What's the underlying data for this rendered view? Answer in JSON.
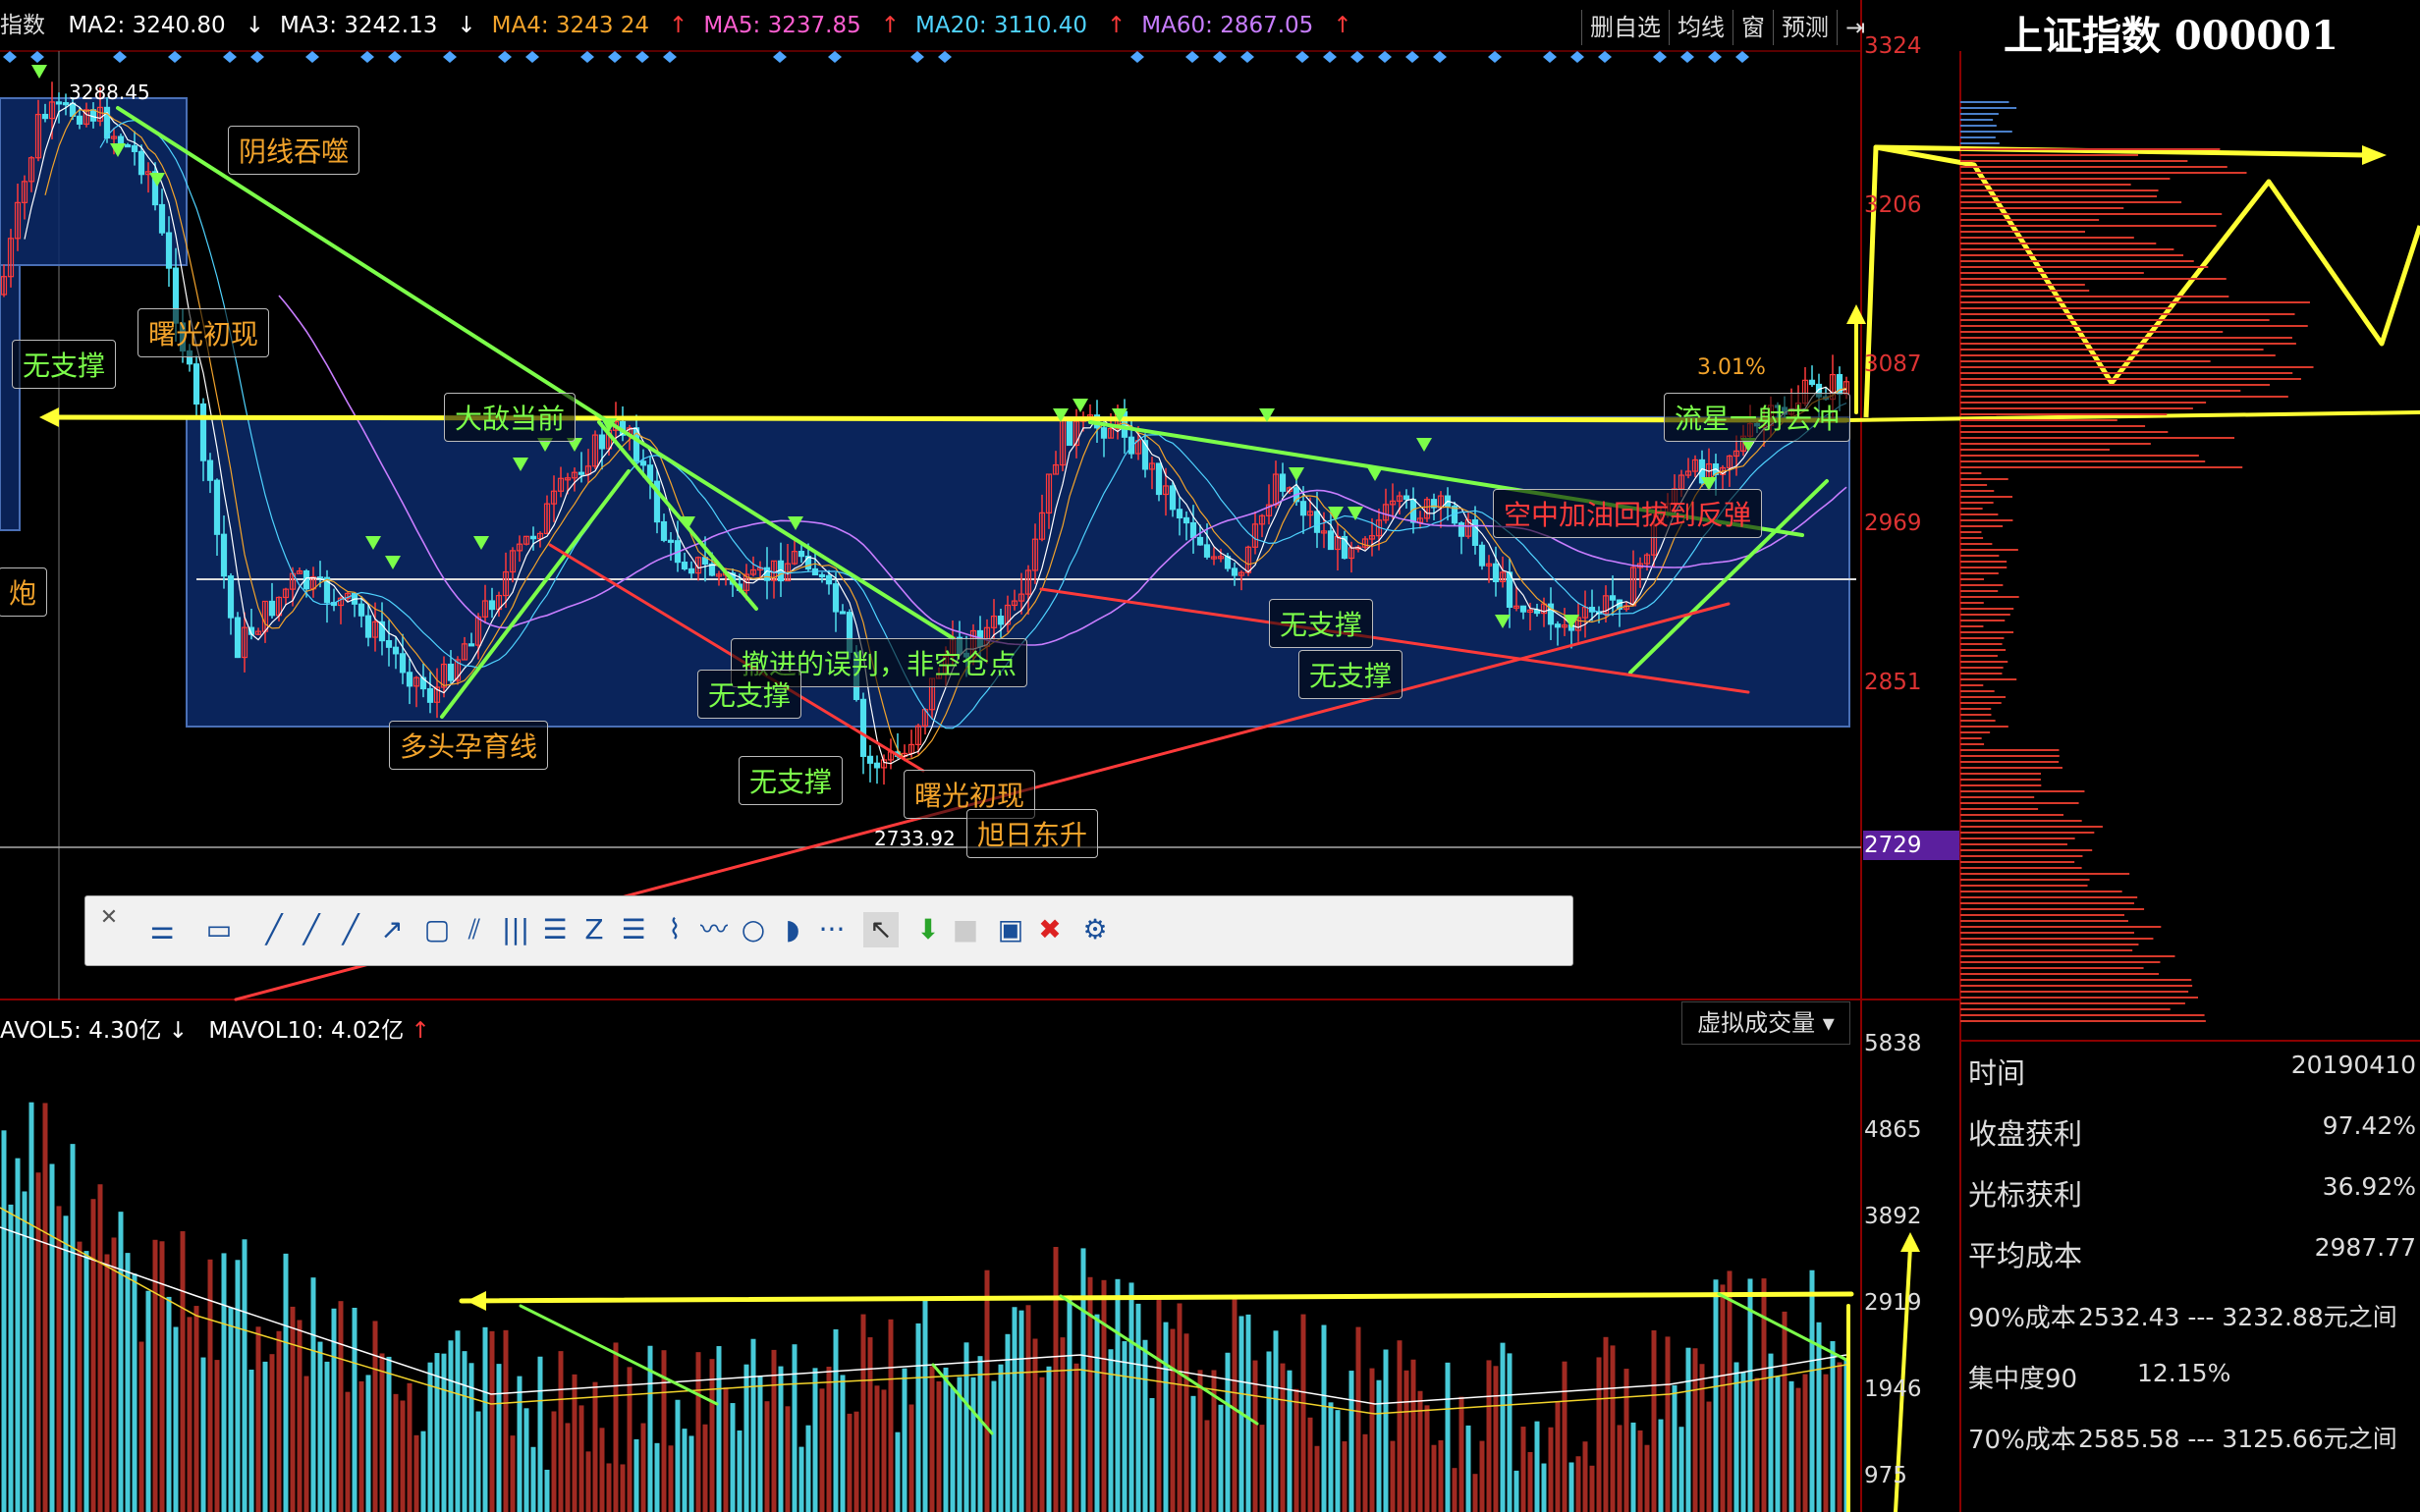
{
  "header": {
    "prefix": "指数",
    "ma": [
      {
        "label": "MA2: 3240.80",
        "arrow": "↓",
        "color": "#ffffff",
        "arrow_color": "#ffffff"
      },
      {
        "label": "MA3: 3242.13",
        "arrow": "↓",
        "color": "#ffffff",
        "arrow_color": "#ffffff"
      },
      {
        "label": "MA4: 3243 24",
        "arrow": "↑",
        "color": "#f2a32b",
        "arrow_color": "#ff3a3a"
      },
      {
        "label": "MA5: 3237.85",
        "arrow": "↑",
        "color": "#ff5fd2",
        "arrow_color": "#ff3a3a"
      },
      {
        "label": "MA20: 3110.40",
        "arrow": "↑",
        "color": "#4fd3ff",
        "arrow_color": "#ff3a3a"
      },
      {
        "label": "MA60: 2867.05",
        "arrow": "↑",
        "color": "#c87dff",
        "arrow_color": "#ff3a3a"
      }
    ],
    "tools": [
      "删自选",
      "均线",
      "窗",
      "预测"
    ],
    "exit_icon": "exit-icon"
  },
  "panel": {
    "title": "上证指数 000001"
  },
  "price_axis": {
    "labels": [
      "3324",
      "3206",
      "3087",
      "2969",
      "2851",
      "2729"
    ],
    "highlight": "2729",
    "highlight_color": "#5b1f9e"
  },
  "volume_axis": {
    "labels": [
      "5838",
      "4865",
      "3892",
      "2919",
      "1946",
      "975"
    ]
  },
  "volume_header": {
    "mavol5": "AVOL5: 4.30亿",
    "mavol5_arrow": "↓",
    "mavol10": "MAVOL10: 4.02亿",
    "mavol10_arrow": "↑",
    "selector": "虚拟成交量"
  },
  "info": [
    {
      "k": "时间",
      "v": "20190410"
    },
    {
      "k": "收盘获利",
      "v": "97.42%"
    },
    {
      "k": "光标获利",
      "v": "36.92%"
    },
    {
      "k": "平均成本",
      "v": "2987.77"
    },
    {
      "k": "90%成本",
      "v": "2532.43 --- 3232.88元之间"
    },
    {
      "k": "集中度90",
      "v": "12.15%"
    },
    {
      "k": "70%成本",
      "v": "2585.58 --- 3125.66元之间"
    }
  ],
  "annotations": [
    {
      "text": "阴线吞噬",
      "color": "#f2a32b"
    },
    {
      "text": "曙光初现",
      "color": "#f2a32b"
    },
    {
      "text": "无支撑",
      "color": "#7cff4a"
    },
    {
      "text": "炮",
      "color": "#f2a32b"
    },
    {
      "text": "大敌当前",
      "color": "#7cff4a"
    },
    {
      "text": "多头孕育线",
      "color": "#f2a32b"
    },
    {
      "text": "撤进的误判，非空仓点",
      "color": "#7cff4a"
    },
    {
      "text": "无支撑",
      "color": "#7cff4a"
    },
    {
      "text": "无支撑",
      "color": "#7cff4a"
    },
    {
      "text": "曙光初现",
      "color": "#f2a32b"
    },
    {
      "text": "旭日东升",
      "color": "#f2a32b"
    },
    {
      "text": "无支撑",
      "color": "#7cff4a"
    },
    {
      "text": "无支撑",
      "color": "#7cff4a"
    },
    {
      "text": "空中加油回拔到反弹",
      "color": "#ff3a3a"
    },
    {
      "text": "流星一射去冲",
      "color": "#7cff4a"
    },
    {
      "text": "3.01%",
      "color": "#f2a32b"
    }
  ],
  "peak_label": "3288.45",
  "low_label": "2733.92",
  "toolbar_tools": [
    "close-icon",
    "settings-lines-icon",
    "abc-text-icon",
    "line-tool-icon",
    "segment-tool-icon",
    "ray-tool-icon",
    "arrow-line-icon",
    "rectangle-tool-icon",
    "parallel-line-icon",
    "vertical-lines-icon",
    "fib-tool-icon",
    "z-line-icon",
    "gann-icon",
    "wave-icon",
    "polyline-icon",
    "circle-tool-icon",
    "arc-tool-icon",
    "more-icon",
    "cursor-icon",
    "green-down-arrow-icon",
    "color-swatch-icon",
    "save-template-icon",
    "delete-icon",
    "gear-icon"
  ],
  "colors": {
    "up": "#ff3a3a",
    "down": "#4fe0f0",
    "trend_green": "#7cff4a",
    "trend_yellow": "#ffff33",
    "zone": "#0c2a6b",
    "grid": "#8b0000"
  }
}
